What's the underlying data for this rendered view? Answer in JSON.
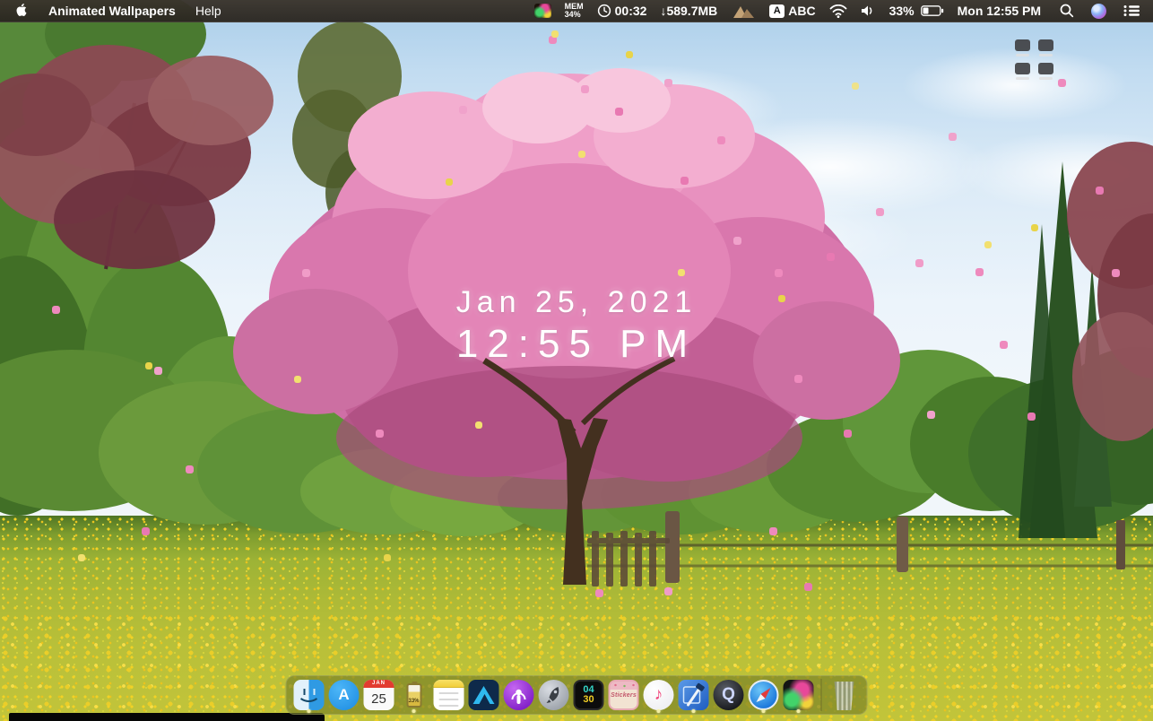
{
  "menu_bar": {
    "app_name": "Animated Wallpapers",
    "menus": {
      "help": "Help"
    },
    "status": {
      "mem_label": "MEM",
      "mem_value": "34%",
      "timer": "00:32",
      "download": "↓589.7MB",
      "input_badge": "A",
      "input_name": "ABC",
      "battery_percent": "33%",
      "date_time": "Mon 12:55 PM"
    },
    "icons": [
      "apple-logo",
      "fireworks-app-icon",
      "clock-icon",
      "mountain-icon",
      "wifi-icon",
      "volume-icon",
      "battery-icon",
      "spotlight-search-icon",
      "siri-icon",
      "notification-list-icon"
    ]
  },
  "desktop": {
    "overlay": {
      "date": "Jan 25, 2021",
      "time": "12:55 PM"
    },
    "grid_icon": "desktop-files-grid"
  },
  "dock": {
    "calendar": {
      "month": "JAN",
      "day": "25"
    },
    "battery_app": {
      "percent": "33%"
    },
    "app_store": {
      "glyph": "A"
    },
    "quicktime": {
      "glyph": "Q"
    },
    "music": {
      "glyph": "♪"
    },
    "countdown": {
      "top": "04",
      "bottom": "30"
    },
    "stickers": {
      "label": "Stickers"
    },
    "items": [
      {
        "name": "finder",
        "running": true
      },
      {
        "name": "app-store",
        "running": false
      },
      {
        "name": "calendar",
        "running": false
      },
      {
        "name": "battery-app",
        "running": true
      },
      {
        "name": "notes",
        "running": false
      },
      {
        "name": "affinity-designer",
        "running": false
      },
      {
        "name": "podcasts",
        "running": false
      },
      {
        "name": "rocket-launcher",
        "running": false
      },
      {
        "name": "countdown",
        "running": false
      },
      {
        "name": "stickers",
        "running": false
      },
      {
        "name": "music",
        "running": true
      },
      {
        "name": "xcode",
        "running": true
      },
      {
        "name": "quicktime",
        "running": false
      },
      {
        "name": "safari",
        "running": true
      },
      {
        "name": "animated-wallpapers",
        "running": true
      },
      {
        "name": "trash",
        "running": false
      }
    ]
  },
  "colors": {
    "menubar_bg": "#2a261e",
    "dock_tint": "#767e26",
    "blossom_pink": "#e879b2",
    "meadow_yellow": "#f3d224",
    "sky_blue": "#a9cde9"
  }
}
